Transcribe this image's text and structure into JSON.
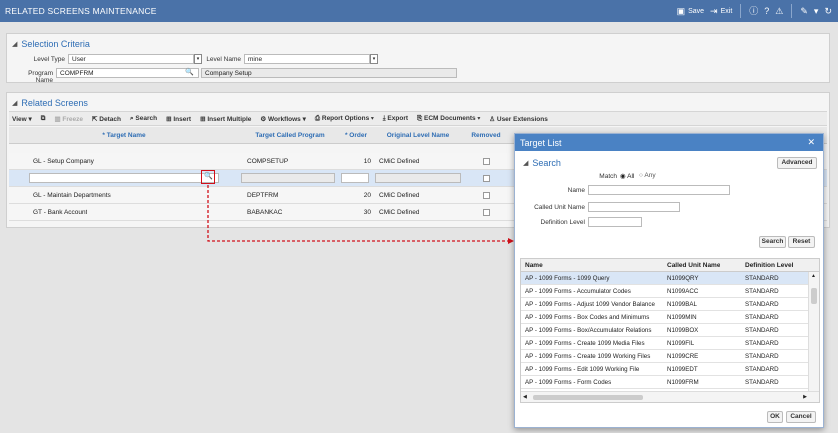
{
  "app": {
    "title": "RELATED SCREENS MAINTENANCE",
    "save": "Save",
    "exit": "Exit"
  },
  "selection": {
    "title": "Selection Criteria",
    "level_type_label": "Level Type",
    "level_type_value": "User",
    "level_name_label": "Level Name",
    "level_name_value": "mine",
    "program_name_label": "Program Name",
    "program_name_value": "COMPFRM",
    "program_desc": "Company Setup"
  },
  "related": {
    "title": "Related Screens",
    "toolbar": {
      "view": "View",
      "freeze": "Freeze",
      "detach": "Detach",
      "search": "Search",
      "insert": "Insert",
      "insert_multiple": "Insert Multiple",
      "workflows": "Workflows",
      "report_options": "Report Options",
      "export": "Export",
      "ecm": "ECM Documents",
      "user_ext": "User Extensions"
    },
    "columns": [
      "* Target Name",
      "Target Called Program",
      "* Order",
      "Original Level Name",
      "Removed"
    ],
    "rows": [
      {
        "name": "GL - Setup Company",
        "program": "COMPSETUP",
        "order": "10",
        "level": "CMiC Defined"
      },
      {
        "name": "",
        "program": "",
        "order": "",
        "level": ""
      },
      {
        "name": "GL - Maintain Departments",
        "program": "DEPTFRM",
        "order": "20",
        "level": "CMiC Defined"
      },
      {
        "name": "GT - Bank Account",
        "program": "BABANKAC",
        "order": "30",
        "level": "CMiC Defined"
      }
    ]
  },
  "modal": {
    "title": "Target List",
    "search_title": "Search",
    "advanced": "Advanced",
    "match_label": "Match",
    "all": "All",
    "any": "Any",
    "name_label": "Name",
    "called_label": "Called Unit Name",
    "def_label": "Definition Level",
    "search_btn": "Search",
    "reset_btn": "Reset",
    "ok": "OK",
    "cancel": "Cancel",
    "columns": [
      "Name",
      "Called Unit Name",
      "Definition Level"
    ],
    "rows": [
      {
        "name": "AP - 1099 Forms - 1099 Query",
        "unit": "N1099QRY",
        "def": "STANDARD"
      },
      {
        "name": "AP - 1099 Forms - Accumulator Codes",
        "unit": "N1099ACC",
        "def": "STANDARD"
      },
      {
        "name": "AP - 1099 Forms - Adjust 1099 Vendor Balance",
        "unit": "N1099BAL",
        "def": "STANDARD"
      },
      {
        "name": "AP - 1099 Forms - Box Codes and Minimums",
        "unit": "N1099MIN",
        "def": "STANDARD"
      },
      {
        "name": "AP - 1099 Forms - Box/Accumulator Relations",
        "unit": "N1099BOX",
        "def": "STANDARD"
      },
      {
        "name": "AP - 1099 Forms - Create 1099 Media Files",
        "unit": "N1099FIL",
        "def": "STANDARD"
      },
      {
        "name": "AP - 1099 Forms - Create 1099 Working Files",
        "unit": "N1099CRE",
        "def": "STANDARD"
      },
      {
        "name": "AP - 1099 Forms - Edit 1099 Working File",
        "unit": "N1099EDT",
        "def": "STANDARD"
      },
      {
        "name": "AP - 1099 Forms - Form Codes",
        "unit": "N1099FRM",
        "def": "STANDARD"
      }
    ]
  }
}
